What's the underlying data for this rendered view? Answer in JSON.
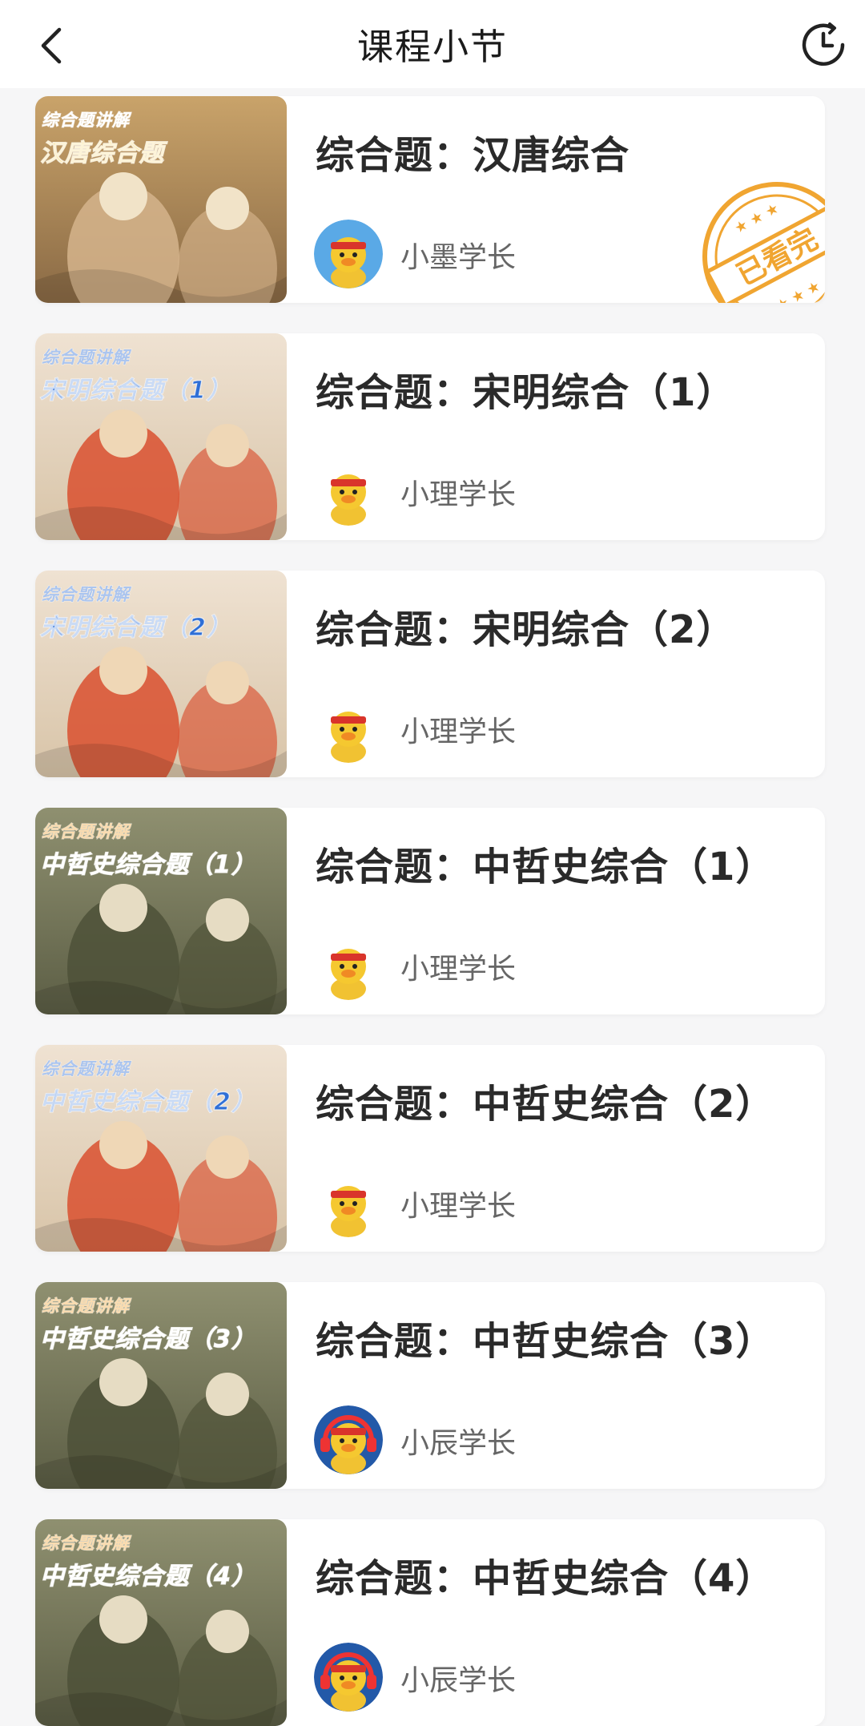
{
  "header": {
    "title": "课程小节",
    "back_icon": "chevron-left-icon",
    "history_icon": "clock-icon"
  },
  "courses": [
    {
      "title": "综合题：汉唐综合",
      "author": "小墨学长",
      "thumb_tag": "综合题讲解",
      "thumb_title": "汉唐综合题",
      "watched_label": "已看完",
      "watched": true,
      "avatar": "duck-blue",
      "theme": "hantang"
    },
    {
      "title": "综合题：宋明综合（1）",
      "author": "小理学长",
      "thumb_tag": "综合题讲解",
      "thumb_title": "宋明综合题（1）",
      "watched_label": "",
      "watched": false,
      "avatar": "duck-plain",
      "theme": "songming"
    },
    {
      "title": "综合题：宋明综合（2）",
      "author": "小理学长",
      "thumb_tag": "综合题讲解",
      "thumb_title": "宋明综合题（2）",
      "watched_label": "",
      "watched": false,
      "avatar": "duck-plain",
      "theme": "songming"
    },
    {
      "title": "综合题：中哲史综合（1）",
      "author": "小理学长",
      "thumb_tag": "综合题讲解",
      "thumb_title": "中哲史综合题（1）",
      "watched_label": "",
      "watched": false,
      "avatar": "duck-plain",
      "theme": "zhezhe"
    },
    {
      "title": "综合题：中哲史综合（2）",
      "author": "小理学长",
      "thumb_tag": "综合题讲解",
      "thumb_title": "中哲史综合题（2）",
      "watched_label": "",
      "watched": false,
      "avatar": "duck-plain",
      "theme": "songming"
    },
    {
      "title": "综合题：中哲史综合（3）",
      "author": "小辰学长",
      "thumb_tag": "综合题讲解",
      "thumb_title": "中哲史综合题（3）",
      "watched_label": "",
      "watched": false,
      "avatar": "duck-headphones",
      "theme": "zhezhe"
    },
    {
      "title": "综合题：中哲史综合（4）",
      "author": "小辰学长",
      "thumb_tag": "综合题讲解",
      "thumb_title": "中哲史综合题（4）",
      "watched_label": "",
      "watched": false,
      "avatar": "duck-headphones",
      "theme": "zhezhe"
    }
  ],
  "colors": {
    "accent_stamp": "#f0a531",
    "title_text": "#2a2a2a",
    "author_text": "#666666",
    "thumb_blue_text": "#2f6fd6",
    "thumb_gold_text": "#f3a93a"
  }
}
